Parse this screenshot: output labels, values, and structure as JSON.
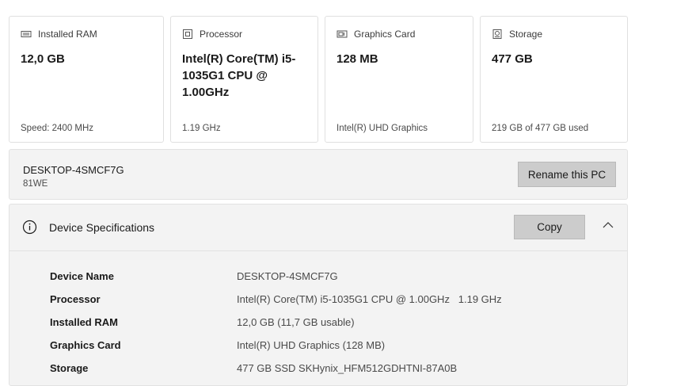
{
  "cards": [
    {
      "title": "Installed RAM",
      "icon": "memory-icon",
      "value": "12,0 GB",
      "sub": "Speed: 2400 MHz"
    },
    {
      "title": "Processor",
      "icon": "processor-icon",
      "value": "Intel(R) Core(TM) i5-1035G1 CPU @ 1.00GHz",
      "sub": "1.19 GHz"
    },
    {
      "title": "Graphics Card",
      "icon": "graphics-card-icon",
      "value": "128 MB",
      "sub": "Intel(R) UHD Graphics"
    },
    {
      "title": "Storage",
      "icon": "storage-icon",
      "value": "477 GB",
      "sub": "219 GB of 477 GB used"
    }
  ],
  "pc": {
    "name": "DESKTOP-4SMCF7G",
    "model": "81WE",
    "rename_label": "Rename this PC"
  },
  "specs": {
    "title": "Device Specifications",
    "copy_label": "Copy",
    "rows": [
      {
        "label": "Device Name",
        "value": "DESKTOP-4SMCF7G"
      },
      {
        "label": "Processor",
        "value": "Intel(R) Core(TM) i5-1035G1 CPU @ 1.00GHz   1.19 GHz"
      },
      {
        "label": "Installed RAM",
        "value": "12,0 GB (11,7 GB usable)"
      },
      {
        "label": "Graphics Card",
        "value": "Intel(R) UHD Graphics (128 MB)"
      },
      {
        "label": "Storage",
        "value": "477 GB SSD SKHynix_HFM512GDHTNI-87A0B"
      }
    ]
  }
}
